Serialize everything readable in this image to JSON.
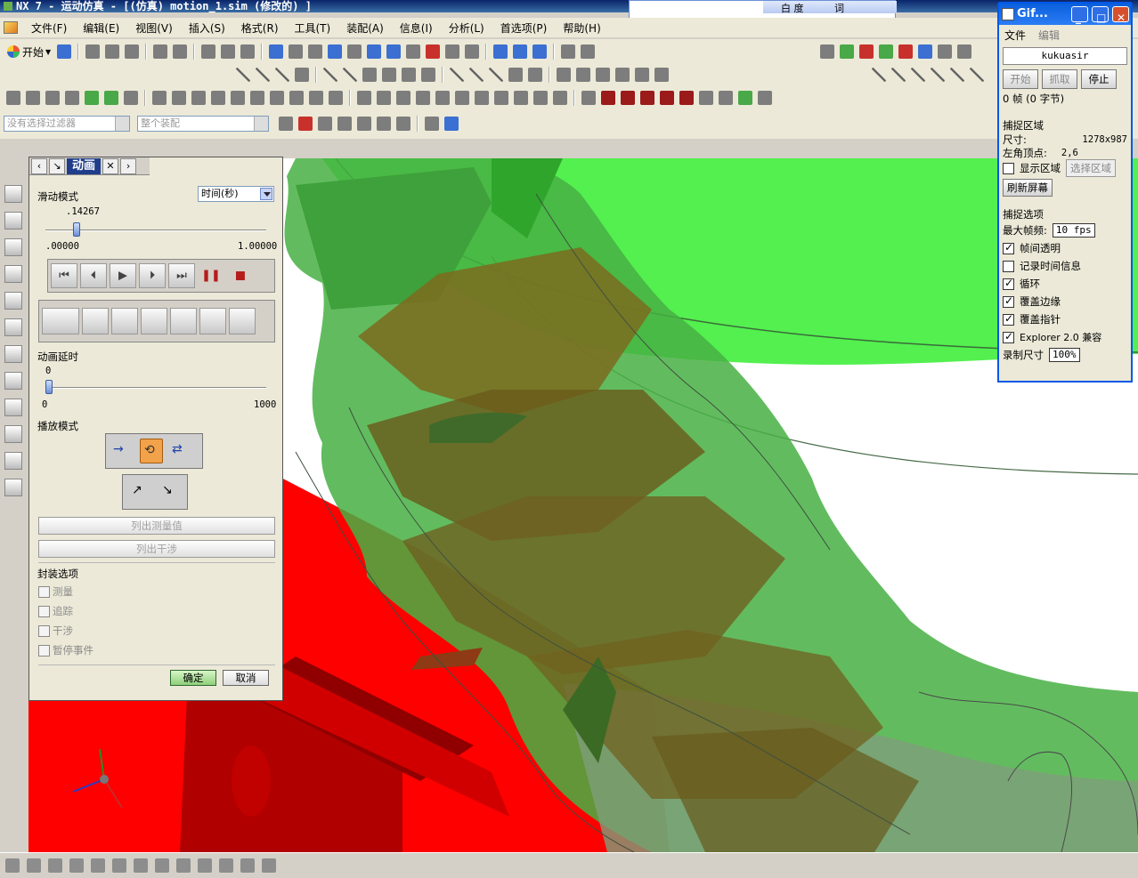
{
  "window": {
    "title": "NX 7 - 运动仿真 - [(仿真) motion_1.sim  (修改的) ]"
  },
  "menu": {
    "items": [
      "文件(F)",
      "编辑(E)",
      "视图(V)",
      "插入(S)",
      "格式(R)",
      "工具(T)",
      "装配(A)",
      "信息(I)",
      "分析(L)",
      "首选项(P)",
      "帮助(H)"
    ]
  },
  "toolbar": {
    "start_label": "开始",
    "filter_placeholder": "没有选择过滤器",
    "assembly_scope": "整个装配"
  },
  "ime": {
    "label": "白 度",
    "label2": "词"
  },
  "animation_dialog": {
    "title": "动画",
    "slide_mode_label": "滑动模式",
    "slide_mode_value": "时间(秒)",
    "time_value": ".14267",
    "time_progress": 0.14267,
    "time_min": ".00000",
    "time_max": "1.00000",
    "delay_label": "动画延时",
    "delay_value": "0",
    "delay_min": "0",
    "delay_max": "1000",
    "play_mode_label": "播放模式",
    "list_measure_label": "列出测量值",
    "list_interference_label": "列出干涉",
    "package_options_label": "封装选项",
    "options": [
      "测量",
      "追踪",
      "干涉",
      "暂停事件"
    ],
    "ok_label": "确定",
    "cancel_label": "取消"
  },
  "gif_recorder": {
    "title": "Gif...",
    "menu_file": "文件",
    "menu_edit": "编辑",
    "name": "kukuasir",
    "btn_start": "开始",
    "btn_capture": "抓取",
    "btn_stop": "停止",
    "frame_info": "0 帧  (0 字节)",
    "capture_region_title": "捕捉区域",
    "size_label": "尺寸:",
    "size_value": "1278x987",
    "corner_label": "左角顶点:",
    "corner_value": "2,6",
    "show_region_label": "显示区域",
    "select_region_label": "选择区域",
    "refresh_label": "刷新屏幕",
    "capture_options_title": "捕捉选项",
    "max_fps_label": "最大帧频:",
    "max_fps_value": "10 fps",
    "opt_transparent": "帧间透明",
    "opt_timing": "记录时间信息",
    "opt_loop": "循环",
    "opt_edges": "覆盖边缘",
    "opt_pointer": "覆盖指针",
    "opt_explorer": "Explorer 2.0 兼容",
    "record_size_label": "录制尺寸",
    "record_size_value": "100%"
  },
  "colors": {
    "accent": "#0a246a",
    "green_body": "#4fc44a",
    "red_body": "#ff0000",
    "brown_overlap": "#7d6b1e"
  }
}
